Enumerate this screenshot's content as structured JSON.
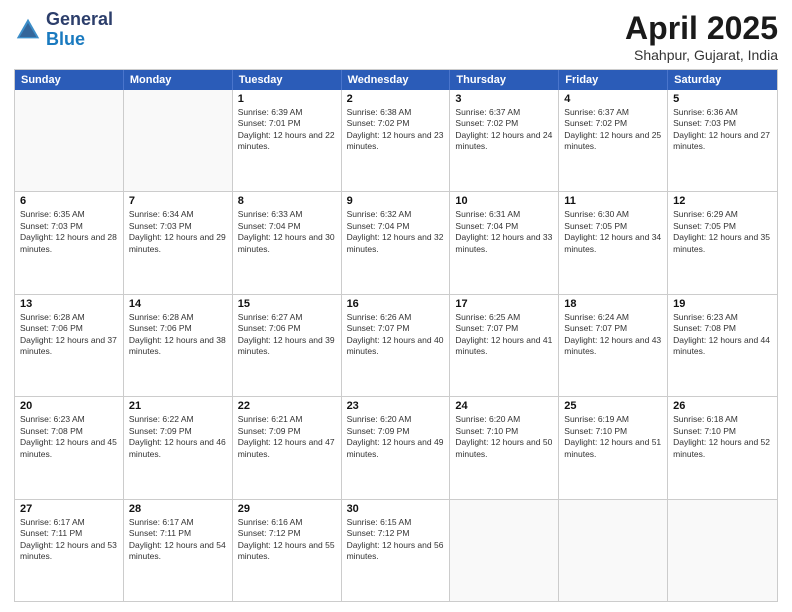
{
  "header": {
    "logo_general": "General",
    "logo_blue": "Blue",
    "title": "April 2025",
    "location": "Shahpur, Gujarat, India"
  },
  "weekdays": [
    "Sunday",
    "Monday",
    "Tuesday",
    "Wednesday",
    "Thursday",
    "Friday",
    "Saturday"
  ],
  "rows": [
    [
      {
        "day": "",
        "text": ""
      },
      {
        "day": "",
        "text": ""
      },
      {
        "day": "1",
        "text": "Sunrise: 6:39 AM\nSunset: 7:01 PM\nDaylight: 12 hours and 22 minutes."
      },
      {
        "day": "2",
        "text": "Sunrise: 6:38 AM\nSunset: 7:02 PM\nDaylight: 12 hours and 23 minutes."
      },
      {
        "day": "3",
        "text": "Sunrise: 6:37 AM\nSunset: 7:02 PM\nDaylight: 12 hours and 24 minutes."
      },
      {
        "day": "4",
        "text": "Sunrise: 6:37 AM\nSunset: 7:02 PM\nDaylight: 12 hours and 25 minutes."
      },
      {
        "day": "5",
        "text": "Sunrise: 6:36 AM\nSunset: 7:03 PM\nDaylight: 12 hours and 27 minutes."
      }
    ],
    [
      {
        "day": "6",
        "text": "Sunrise: 6:35 AM\nSunset: 7:03 PM\nDaylight: 12 hours and 28 minutes."
      },
      {
        "day": "7",
        "text": "Sunrise: 6:34 AM\nSunset: 7:03 PM\nDaylight: 12 hours and 29 minutes."
      },
      {
        "day": "8",
        "text": "Sunrise: 6:33 AM\nSunset: 7:04 PM\nDaylight: 12 hours and 30 minutes."
      },
      {
        "day": "9",
        "text": "Sunrise: 6:32 AM\nSunset: 7:04 PM\nDaylight: 12 hours and 32 minutes."
      },
      {
        "day": "10",
        "text": "Sunrise: 6:31 AM\nSunset: 7:04 PM\nDaylight: 12 hours and 33 minutes."
      },
      {
        "day": "11",
        "text": "Sunrise: 6:30 AM\nSunset: 7:05 PM\nDaylight: 12 hours and 34 minutes."
      },
      {
        "day": "12",
        "text": "Sunrise: 6:29 AM\nSunset: 7:05 PM\nDaylight: 12 hours and 35 minutes."
      }
    ],
    [
      {
        "day": "13",
        "text": "Sunrise: 6:28 AM\nSunset: 7:06 PM\nDaylight: 12 hours and 37 minutes."
      },
      {
        "day": "14",
        "text": "Sunrise: 6:28 AM\nSunset: 7:06 PM\nDaylight: 12 hours and 38 minutes."
      },
      {
        "day": "15",
        "text": "Sunrise: 6:27 AM\nSunset: 7:06 PM\nDaylight: 12 hours and 39 minutes."
      },
      {
        "day": "16",
        "text": "Sunrise: 6:26 AM\nSunset: 7:07 PM\nDaylight: 12 hours and 40 minutes."
      },
      {
        "day": "17",
        "text": "Sunrise: 6:25 AM\nSunset: 7:07 PM\nDaylight: 12 hours and 41 minutes."
      },
      {
        "day": "18",
        "text": "Sunrise: 6:24 AM\nSunset: 7:07 PM\nDaylight: 12 hours and 43 minutes."
      },
      {
        "day": "19",
        "text": "Sunrise: 6:23 AM\nSunset: 7:08 PM\nDaylight: 12 hours and 44 minutes."
      }
    ],
    [
      {
        "day": "20",
        "text": "Sunrise: 6:23 AM\nSunset: 7:08 PM\nDaylight: 12 hours and 45 minutes."
      },
      {
        "day": "21",
        "text": "Sunrise: 6:22 AM\nSunset: 7:09 PM\nDaylight: 12 hours and 46 minutes."
      },
      {
        "day": "22",
        "text": "Sunrise: 6:21 AM\nSunset: 7:09 PM\nDaylight: 12 hours and 47 minutes."
      },
      {
        "day": "23",
        "text": "Sunrise: 6:20 AM\nSunset: 7:09 PM\nDaylight: 12 hours and 49 minutes."
      },
      {
        "day": "24",
        "text": "Sunrise: 6:20 AM\nSunset: 7:10 PM\nDaylight: 12 hours and 50 minutes."
      },
      {
        "day": "25",
        "text": "Sunrise: 6:19 AM\nSunset: 7:10 PM\nDaylight: 12 hours and 51 minutes."
      },
      {
        "day": "26",
        "text": "Sunrise: 6:18 AM\nSunset: 7:10 PM\nDaylight: 12 hours and 52 minutes."
      }
    ],
    [
      {
        "day": "27",
        "text": "Sunrise: 6:17 AM\nSunset: 7:11 PM\nDaylight: 12 hours and 53 minutes."
      },
      {
        "day": "28",
        "text": "Sunrise: 6:17 AM\nSunset: 7:11 PM\nDaylight: 12 hours and 54 minutes."
      },
      {
        "day": "29",
        "text": "Sunrise: 6:16 AM\nSunset: 7:12 PM\nDaylight: 12 hours and 55 minutes."
      },
      {
        "day": "30",
        "text": "Sunrise: 6:15 AM\nSunset: 7:12 PM\nDaylight: 12 hours and 56 minutes."
      },
      {
        "day": "",
        "text": ""
      },
      {
        "day": "",
        "text": ""
      },
      {
        "day": "",
        "text": ""
      }
    ]
  ]
}
